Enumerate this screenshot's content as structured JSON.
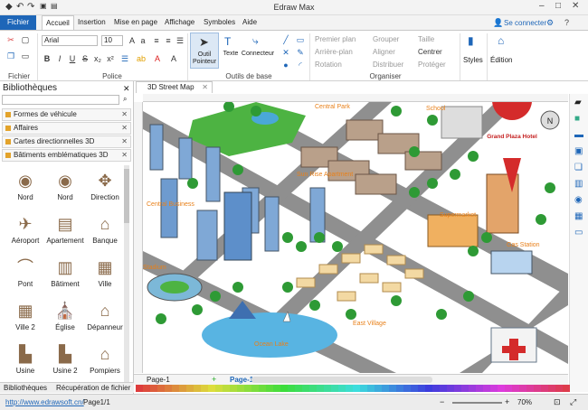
{
  "app": {
    "title": "Edraw Max"
  },
  "quick_access": {
    "undo": "↶",
    "redo": "↷",
    "save": "💾",
    "print": "🖨"
  },
  "window": {
    "minimize": "–",
    "maximize": "□",
    "close": "✕"
  },
  "tabs": [
    {
      "label": "Fichier"
    },
    {
      "label": "Accueil"
    },
    {
      "label": "Insertion"
    },
    {
      "label": "Mise en page"
    },
    {
      "label": "Affichage"
    },
    {
      "label": "Symboles"
    },
    {
      "label": "Aide"
    }
  ],
  "account": {
    "connect": "Se connecter"
  },
  "ribbon": {
    "font_name": "Arial",
    "font_size": "10",
    "groups": {
      "fichier": "Fichier",
      "police": "Police",
      "outils": "Outils de base",
      "organiser": "Organiser"
    },
    "tool_pointer": "Outil Pointeur",
    "tool_text": "Texte",
    "tool_connector": "Connecteur",
    "first_plan": "Premier plan",
    "back_plan": "Arrière-plan",
    "rotation": "Rotation",
    "group": "Grouper",
    "align": "Aligner",
    "distribute": "Distribuer",
    "size": "Taille",
    "center": "Centrer",
    "protect": "Protéger",
    "styles": "Styles",
    "edition": "Édition",
    "font_btns": [
      "B",
      "I",
      "U",
      "S",
      "x₂",
      "x²",
      "ab"
    ]
  },
  "library": {
    "title": "Bibliothèques",
    "categories": [
      "Formes de véhicule",
      "Affaires",
      "Cartes directionnelles 3D",
      "Bâtiments emblématiques 3D"
    ],
    "shapes": [
      {
        "label": "Nord",
        "icon": "compass-icon"
      },
      {
        "label": "Nord",
        "icon": "compass-icon"
      },
      {
        "label": "Direction",
        "icon": "direction-icon"
      },
      {
        "label": "Aéroport",
        "icon": "airplane-icon"
      },
      {
        "label": "Apartement",
        "icon": "apartment-icon"
      },
      {
        "label": "Banque",
        "icon": "bank-icon"
      },
      {
        "label": "Pont",
        "icon": "bridge-icon"
      },
      {
        "label": "Bâtiment",
        "icon": "building-icon"
      },
      {
        "label": "Ville",
        "icon": "city-icon"
      },
      {
        "label": "Ville 2",
        "icon": "city2-icon"
      },
      {
        "label": "Église",
        "icon": "church-icon"
      },
      {
        "label": "Dépanneur",
        "icon": "store-icon"
      },
      {
        "label": "Usine",
        "icon": "factory-icon"
      },
      {
        "label": "Usine 2",
        "icon": "factory2-icon"
      },
      {
        "label": "Pompiers",
        "icon": "firestation-icon"
      }
    ],
    "bottom_tabs": [
      "Bibliothèques",
      "Récupération de fichier"
    ]
  },
  "document": {
    "tab": "3D Street Map"
  },
  "map": {
    "labels": {
      "central_park": "Central Park",
      "school": "School",
      "grand_plaza": "Grand Plaza Hotel",
      "sunrise": "Sun Rise Apartment",
      "central_business": "Central Business",
      "supermarket": "Supermarket",
      "gas_station": "Gas Station",
      "stadium": "Stadium",
      "east_village": "East Village",
      "ocean_lake": "Ocean Lake"
    }
  },
  "pages": {
    "current": "Page-1",
    "active": "Page-1",
    "add": "+"
  },
  "status": {
    "url": "http://www.edrawsoft.cn/",
    "page": "Page1/1",
    "zoom": "70%"
  },
  "colors": {
    "accent": "#1e66b8",
    "road": "#8a8a8a",
    "grass": "#3fa23a",
    "water": "#4aa8d8",
    "label": "#e8801a",
    "pin": "#d42b2b"
  }
}
